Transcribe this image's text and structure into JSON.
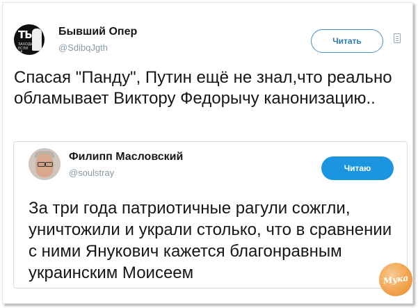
{
  "tweet": {
    "author_name": "Бывший Опер",
    "author_handle": "@SdibqJgth",
    "avatar_text_line1": "ТЫ",
    "avatar_text_line2": "ЗАХОДИ ЕСЛИ ЧЁ",
    "follow_label": "Читать",
    "text": "Спасая \"Панду\", Путин ещё не знал,что реально обламывает Виктору Федорычу канонизацию.."
  },
  "quoted_tweet": {
    "author_name": "Филипп Масловский",
    "author_handle": "@soulstray",
    "follow_label": "Читаю",
    "text": "За три года патриотичные рагули сожгли, уничтожили и украли столько, что в сравнении с ними Янукович кажется благонравным украинским Моисеем"
  },
  "watermark": {
    "text": "Мука"
  },
  "colors": {
    "accent": "#1b95e0",
    "text": "#14171a",
    "muted": "#8899a6"
  },
  "icons": {
    "more": "more-icon"
  }
}
